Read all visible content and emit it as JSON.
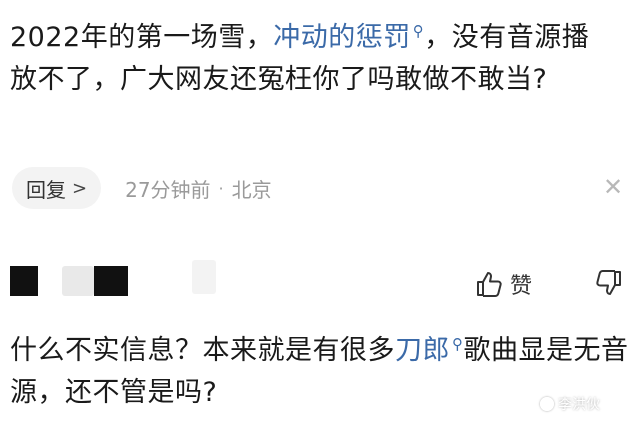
{
  "comment1": {
    "text_before_link": "2022年的第一场雪，",
    "link": "冲动的惩罚",
    "text_after_link": "，没有音源播放不了，广大网友还冤枉你了吗敢做不敢当?"
  },
  "meta": {
    "reply_label": "回复",
    "reply_icon": "chevron-right-icon",
    "time": "27分钟前",
    "separator": "·",
    "location": "北京",
    "close_icon": "close-icon"
  },
  "comment2": {
    "like_label": "赞",
    "like_icon": "thumbs-up-icon",
    "dislike_icon": "thumbs-down-icon",
    "text_before_link": "什么不实信息？本来就是有很多",
    "link": "刀郎",
    "text_after_link": "歌曲显是无音源，还不管是吗?"
  },
  "watermark": {
    "text": "李洪伙"
  },
  "colors": {
    "link": "#3b6aa8",
    "meta": "#9a9a9a",
    "text": "#1a1a1a"
  }
}
